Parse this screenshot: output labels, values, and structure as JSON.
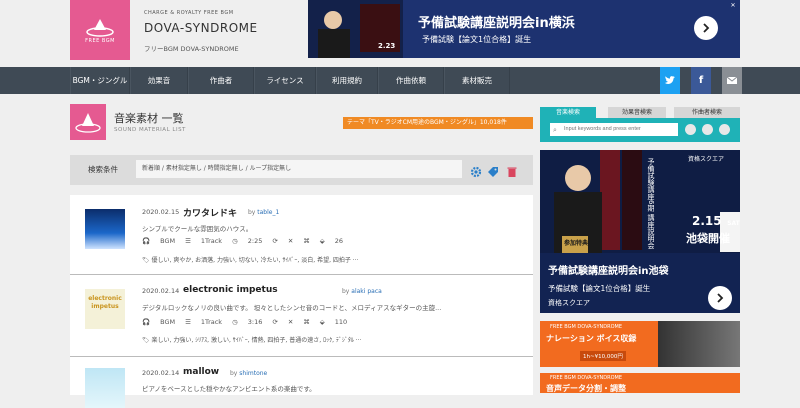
{
  "header": {
    "logo_text": "FREE BGM",
    "brand_tag": "CHARGE & ROYALTY FREE BGM",
    "brand_name": "DOVA-SYNDROME",
    "brand_sub": "フリーBGM DOVA-SYNDROME",
    "ad": {
      "title": "予備試験講座説明会in横浜",
      "subtitle": "予備試験【論文1位合格】誕生",
      "date_badge": "2.23"
    }
  },
  "nav": {
    "items": [
      "BGM・ジングル",
      "効果音",
      "作曲者",
      "ライセンス",
      "利用規約",
      "作曲依頼",
      "素材販売"
    ]
  },
  "page": {
    "title": "音楽素材 一覧",
    "subtitle": "SOUND MATERIAL LIST",
    "theme_badge": "テーマ「TV・ラジオCM用途のBGM・ジングル」10,018件"
  },
  "filter": {
    "label": "検索条件",
    "value": "新着順 / 素材指定無し / 時間指定無し / ループ指定無し"
  },
  "tracks": [
    {
      "date": "2020.02.15",
      "title": "カワタレドキ",
      "by_label": "by",
      "author": "table_1",
      "desc": "シンプルでクールな雰囲気のハウス。",
      "type": "BGM",
      "tracks": "1Track",
      "duration": "2:25",
      "downloads": "26",
      "tags": "優しい, 爽やか, お洒落, 力強い, 切ない, 冷たい, ｻｲﾊﾞｰ, 淡白, 希望, 四拍子 ···"
    },
    {
      "date": "2020.02.14",
      "title": "electronic impetus",
      "by_label": "by",
      "author": "alaki paca",
      "desc": "デジタルロックなノリの良い曲です。 坦々としたシンセ音のコードと、メロディアスなギターの主旋...",
      "type": "BGM",
      "tracks": "1Track",
      "duration": "3:16",
      "downloads": "110",
      "tags": "楽しい, 力強い, ｼﾘｱｽ, 激しい, ｻｲﾊﾞｰ, 情熱, 四拍子, 普通の速さ, ﾛｯｸ, ﾃﾞｼﾞﾀﾙ ···",
      "thumb_text": "electronic impetus"
    },
    {
      "date": "2020.02.14",
      "title": "mallow",
      "by_label": "by",
      "author": "shimtone",
      "desc": "ピアノをベースとした穏やかなアンビエント系の楽曲です。"
    }
  ],
  "sidebar": {
    "tabs": [
      "音楽検索",
      "効果音検索",
      "作曲者検索"
    ],
    "search_placeholder": "Input keywords and press enter",
    "ad": {
      "brand": "資格スクエア",
      "title": "予備試験講座説明会in池袋",
      "subtitle": "予備試験【論文1位合格】誕生",
      "footer": "資格スクエア",
      "date": "2.15",
      "weekday": "SAT",
      "venue": "池袋開催",
      "badge": "参加特典",
      "vertical_text": "予備試験講座6期 講座説明会"
    },
    "ad2": {
      "header": "FREE BGM DOVA-SYNDROME",
      "title": "ナレーション ボイス収録",
      "price": "1h~¥10,000円"
    },
    "ad3": {
      "header": "FREE BGM DOVA-SYNDROME",
      "title": "音声データ分割・調整"
    }
  },
  "colors": {
    "brand_pink": "#e55a91",
    "nav_bg": "#3f4a55",
    "accent_teal": "#1fb2b7",
    "badge_orange": "#f08a24",
    "twitter": "#1da1f2",
    "facebook": "#3b5998"
  }
}
